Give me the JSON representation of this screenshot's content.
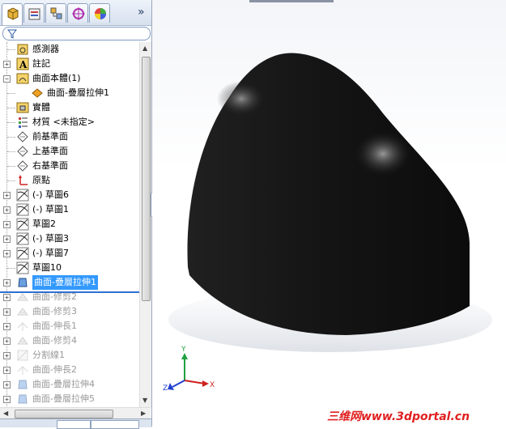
{
  "tabs": [
    {
      "name": "feature-manager-tab-icon",
      "active": true
    },
    {
      "name": "property-manager-tab-icon",
      "active": false
    },
    {
      "name": "configuration-manager-tab-icon",
      "active": false
    },
    {
      "name": "dimxpert-manager-tab-icon",
      "active": false
    },
    {
      "name": "display-manager-tab-icon",
      "active": false
    }
  ],
  "tabs_more": "»",
  "tree": [
    {
      "label": "感測器",
      "icon": "sensors-icon",
      "exp": "",
      "indent": 0,
      "state": "normal"
    },
    {
      "label": "註記",
      "icon": "annotations-icon",
      "exp": "+",
      "indent": 0,
      "state": "normal"
    },
    {
      "label": "曲面本體(1)",
      "icon": "surface-bodies-icon",
      "exp": "−",
      "indent": 0,
      "state": "normal"
    },
    {
      "label": "曲面-疊層拉伸1",
      "icon": "surface-body-icon",
      "exp": "",
      "indent": 1,
      "state": "normal"
    },
    {
      "label": "實體",
      "icon": "solid-bodies-icon",
      "exp": "",
      "indent": 0,
      "state": "normal"
    },
    {
      "label": "材質 <未指定>",
      "icon": "material-icon",
      "exp": "",
      "indent": 0,
      "state": "normal"
    },
    {
      "label": "前基準面",
      "icon": "plane-icon",
      "exp": "",
      "indent": 0,
      "state": "normal"
    },
    {
      "label": "上基準面",
      "icon": "plane-icon",
      "exp": "",
      "indent": 0,
      "state": "normal"
    },
    {
      "label": "右基準面",
      "icon": "plane-icon",
      "exp": "",
      "indent": 0,
      "state": "normal"
    },
    {
      "label": "原點",
      "icon": "origin-icon",
      "exp": "",
      "indent": 0,
      "state": "normal"
    },
    {
      "label": "(-) 草圖6",
      "icon": "sketch-icon",
      "exp": "+",
      "indent": 0,
      "state": "normal"
    },
    {
      "label": "(-) 草圖1",
      "icon": "sketch-icon",
      "exp": "+",
      "indent": 0,
      "state": "normal"
    },
    {
      "label": "草圖2",
      "icon": "sketch-icon",
      "exp": "+",
      "indent": 0,
      "state": "normal"
    },
    {
      "label": "(-) 草圖3",
      "icon": "sketch-icon",
      "exp": "+",
      "indent": 0,
      "state": "normal"
    },
    {
      "label": "(-) 草圖7",
      "icon": "sketch-icon",
      "exp": "+",
      "indent": 0,
      "state": "normal"
    },
    {
      "label": "草圖10",
      "icon": "sketch-icon",
      "exp": "",
      "indent": 0,
      "state": "normal"
    },
    {
      "label": "曲面-疊層拉伸1",
      "icon": "surface-loft-icon",
      "exp": "+",
      "indent": 0,
      "state": "selected"
    },
    {
      "label": "曲面-修剪2",
      "icon": "surface-trim-icon",
      "exp": "+",
      "indent": 0,
      "state": "dim"
    },
    {
      "label": "曲面-修剪3",
      "icon": "surface-trim-icon",
      "exp": "+",
      "indent": 0,
      "state": "dim"
    },
    {
      "label": "曲面-伸長1",
      "icon": "surface-extend-icon",
      "exp": "+",
      "indent": 0,
      "state": "dim"
    },
    {
      "label": "曲面-修剪4",
      "icon": "surface-trim-icon",
      "exp": "+",
      "indent": 0,
      "state": "dim"
    },
    {
      "label": "分割線1",
      "icon": "split-line-icon",
      "exp": "+",
      "indent": 0,
      "state": "dim"
    },
    {
      "label": "曲面-伸長2",
      "icon": "surface-extend-icon",
      "exp": "+",
      "indent": 0,
      "state": "dim"
    },
    {
      "label": "曲面-疊層拉伸4",
      "icon": "surface-loft-icon",
      "exp": "+",
      "indent": 0,
      "state": "dim"
    },
    {
      "label": "曲面-疊層拉伸5",
      "icon": "surface-loft-icon",
      "exp": "+",
      "indent": 0,
      "state": "dim"
    }
  ],
  "triad": {
    "x": "X",
    "y": "Y",
    "z": "Z"
  },
  "watermark": {
    "part1": "三维网",
    "part2": "www.3dportal.cn"
  },
  "colors": {
    "model": "#111111",
    "selection": "#3399ff",
    "axis_x": "#d02020",
    "axis_y": "#20a040",
    "axis_z": "#2040d0"
  }
}
